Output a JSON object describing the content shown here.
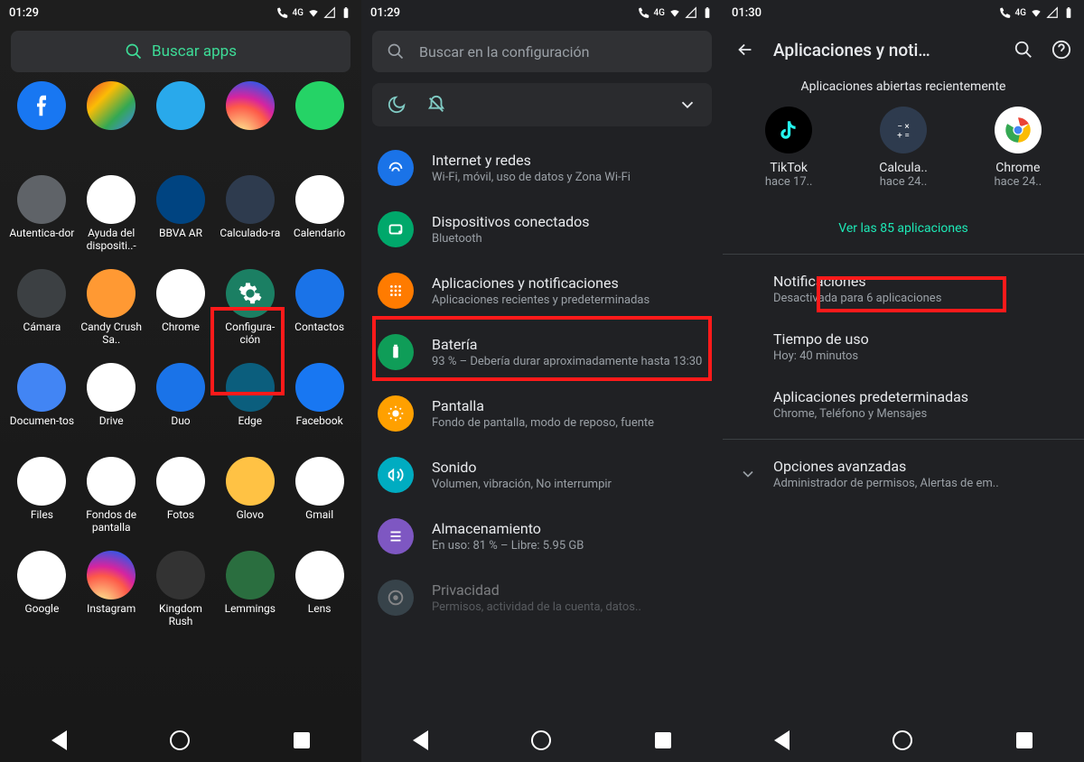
{
  "status": {
    "time1": "01:29",
    "time2": "01:29",
    "time3": "01:30",
    "net": "4G"
  },
  "screen1": {
    "search": "Buscar apps",
    "apps": [
      {
        "n": "",
        "bg": "#1877f2"
      },
      {
        "n": "",
        "bg": "linear-gradient(135deg,#ea4335,#fbbc05,#34a853,#4285f4)"
      },
      {
        "n": "",
        "bg": "#29a9eb"
      },
      {
        "n": "",
        "bg": "radial-gradient(circle at 30% 110%,#fdf497 0%,#fd5949 45%,#d6249f 60%,#285AEB 90%)"
      },
      {
        "n": "",
        "bg": "#25d366"
      },
      {
        "n": "Autentica-dor",
        "bg": "#5f6368"
      },
      {
        "n": "Ayuda del dispositi..-",
        "bg": "#fff",
        "fg": "#1a73e8"
      },
      {
        "n": "BBVA AR",
        "bg": "#004481"
      },
      {
        "n": "Calculado-ra",
        "bg": "#2e3b4e"
      },
      {
        "n": "Calendario",
        "bg": "#fff"
      },
      {
        "n": "Cámara",
        "bg": "#3c4043"
      },
      {
        "n": "Candy Crush Sa..",
        "bg": "#ff9933"
      },
      {
        "n": "Chrome",
        "bg": "#fff"
      },
      {
        "n": "Configura-ción",
        "bg": "#1b7f63"
      },
      {
        "n": "Contactos",
        "bg": "#1a73e8"
      },
      {
        "n": "Documen-tos",
        "bg": "#4285f4"
      },
      {
        "n": "Drive",
        "bg": "#fff"
      },
      {
        "n": "Duo",
        "bg": "#1a73e8"
      },
      {
        "n": "Edge",
        "bg": "#0b5e7d"
      },
      {
        "n": "Facebook",
        "bg": "#1877f2"
      },
      {
        "n": "Files",
        "bg": "#fff"
      },
      {
        "n": "Fondos de pantalla",
        "bg": "#fff"
      },
      {
        "n": "Fotos",
        "bg": "#fff"
      },
      {
        "n": "Glovo",
        "bg": "#ffc244"
      },
      {
        "n": "Gmail",
        "bg": "#fff"
      },
      {
        "n": "Google",
        "bg": "#fff"
      },
      {
        "n": "Instagram",
        "bg": "radial-gradient(circle at 30% 110%,#fdf497 0%,#fd5949 45%,#d6249f 60%,#285AEB 90%)"
      },
      {
        "n": "Kingdom Rush",
        "bg": "#333"
      },
      {
        "n": "Lemmings",
        "bg": "#2a6e3f"
      },
      {
        "n": "Lens",
        "bg": "#fff"
      }
    ]
  },
  "screen2": {
    "search": "Buscar en la configuración",
    "items": [
      {
        "t": "Internet y redes",
        "d": "Wi-Fi, móvil, uso de datos y Zona Wi-Fi",
        "bg": "#1a73e8"
      },
      {
        "t": "Dispositivos conectados",
        "d": "Bluetooth",
        "bg": "#00a86b"
      },
      {
        "t": "Aplicaciones y notificaciones",
        "d": "Aplicaciones recientes y predeterminadas",
        "bg": "#ff7b00"
      },
      {
        "t": "Batería",
        "d": "93 % – Debería durar aproximadamente hasta 13:30",
        "bg": "#0f9d58"
      },
      {
        "t": "Pantalla",
        "d": "Fondo de pantalla, modo de reposo, fuente",
        "bg": "#ffa000"
      },
      {
        "t": "Sonido",
        "d": "Volumen, vibración, No interrumpir",
        "bg": "#00acc1"
      },
      {
        "t": "Almacenamiento",
        "d": "En uso: 81 % – Libre: 5.95 GB",
        "bg": "#7e57c2"
      },
      {
        "t": "Privacidad",
        "d": "Permisos, actividad de la cuenta, datos..",
        "bg": "#546e7a"
      }
    ]
  },
  "screen3": {
    "title": "Aplicaciones y noti…",
    "section": "Aplicaciones abiertas recientemente",
    "recent": [
      {
        "n": "TikTok",
        "s": "hace 17..",
        "bg": "#000"
      },
      {
        "n": "Calcula..",
        "s": "hace 24..",
        "bg": "#2e3b4e"
      },
      {
        "n": "Chrome",
        "s": "hace 24..",
        "bg": "#fff"
      }
    ],
    "see_all": "Ver las 85 aplicaciones",
    "list": [
      {
        "t": "Notificaciones",
        "d": "Desactivada para 6 aplicaciones"
      },
      {
        "t": "Tiempo de uso",
        "d": "Hoy: 40 minutos"
      },
      {
        "t": "Aplicaciones predeterminadas",
        "d": "Chrome, Teléfono y Mensajes"
      },
      {
        "t": "Opciones avanzadas",
        "d": "Administrador de permisos, Alertas de em..",
        "chev": true
      }
    ]
  }
}
